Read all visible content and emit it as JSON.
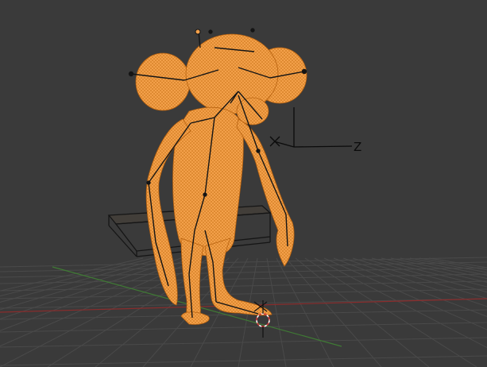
{
  "viewport": {
    "background": "#3a3a3a",
    "grid_color": "#4a4a4a",
    "x_axis_color": "#8a2c2c",
    "y_axis_color": "#3f7a34"
  },
  "gizmo": {
    "axis_label": "Z",
    "icon": "empty-axes-icon",
    "color": "#0b0b0b"
  },
  "cursor": {
    "icon": "3d-cursor-icon"
  },
  "model": {
    "wire_color": "#f5a24a",
    "bone_color": "#151515",
    "selection": "selected"
  },
  "lattice": {
    "icon": "lattice-cage-icon"
  }
}
